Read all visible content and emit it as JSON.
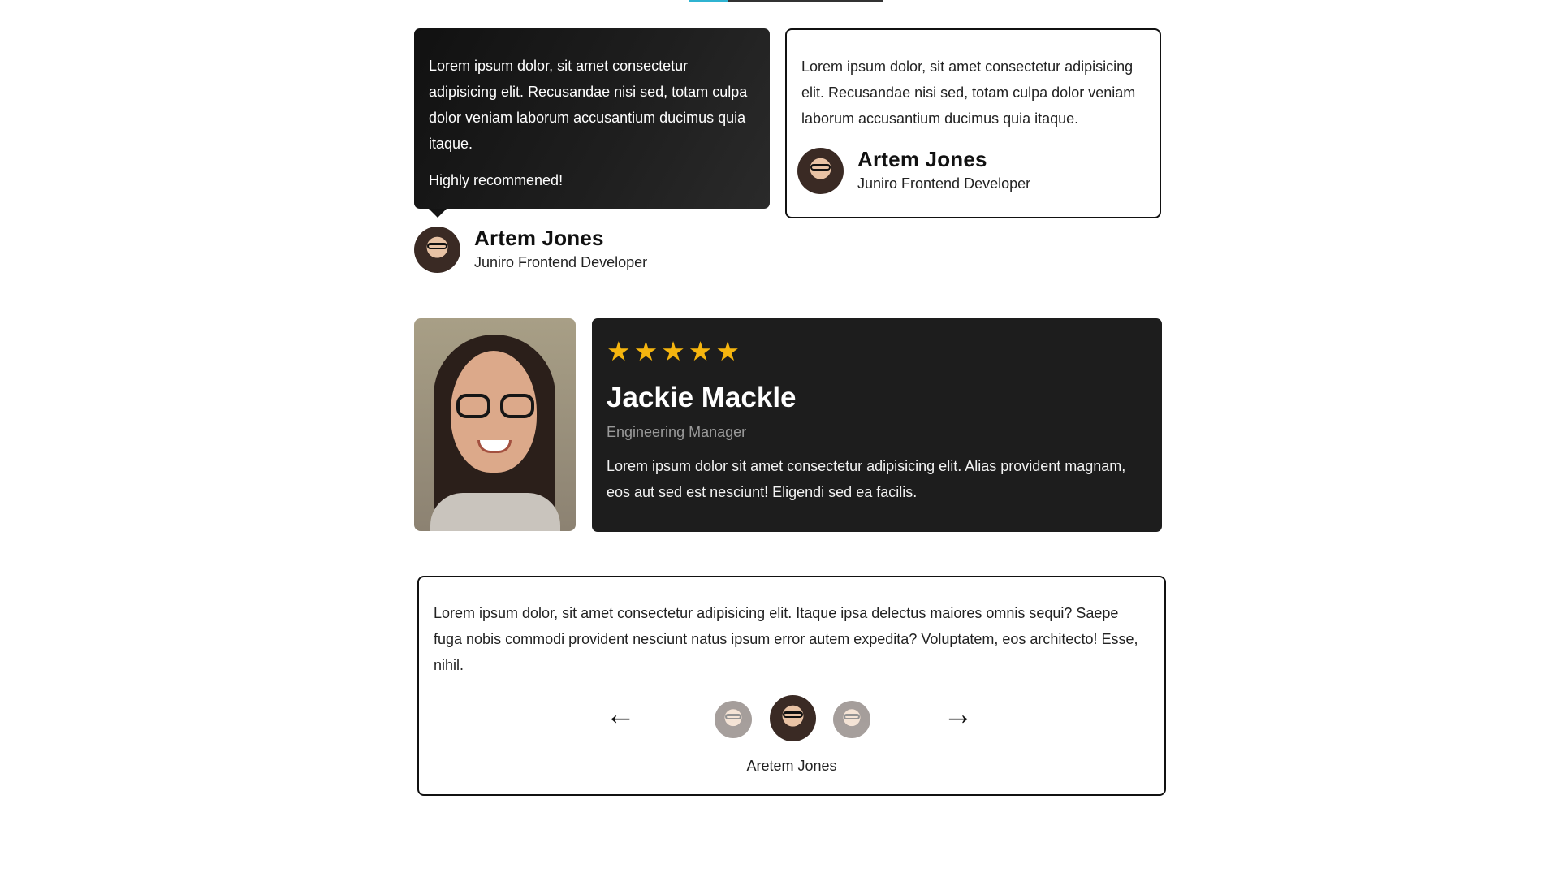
{
  "card1": {
    "quote": "Lorem ipsum dolor, sit amet consectetur adipisicing elit. Recusandae nisi sed, totam culpa dolor veniam laborum accusantium ducimus quia itaque.",
    "highlight": "Highly recommened!",
    "author": {
      "name": "Artem Jones",
      "role": "Juniro Frontend Developer"
    }
  },
  "card2": {
    "quote": "Lorem ipsum dolor, sit amet consectetur adipisicing elit. Recusandae nisi sed, totam culpa dolor veniam laborum accusantium ducimus quia itaque.",
    "author": {
      "name": "Artem Jones",
      "role": "Juniro Frontend Developer"
    }
  },
  "card3": {
    "stars": [
      "★",
      "★",
      "★",
      "★",
      "★"
    ],
    "star_color": "#f5b50f",
    "name": "Jackie Mackle",
    "role": "Engineering Manager",
    "text": "Lorem ipsum dolor sit amet consectetur adipisicing elit. Alias provident magnam, eos aut sed est nesciunt! Eligendi sed ea facilis."
  },
  "card4": {
    "text": "Lorem ipsum dolor, sit amet consectetur adipisicing elit. Itaque ipsa delectus maiores omnis sequi? Saepe fuga nobis commodi provident nesciunt natus ipsum error autem expedita? Voluptatem, eos architecto! Esse, nihil.",
    "prev_icon": "←",
    "next_icon": "→",
    "active_name": "Aretem Jones"
  },
  "colors": {
    "accent_tab": "#2fb3d1",
    "dark_card": "#1d1d1d"
  }
}
